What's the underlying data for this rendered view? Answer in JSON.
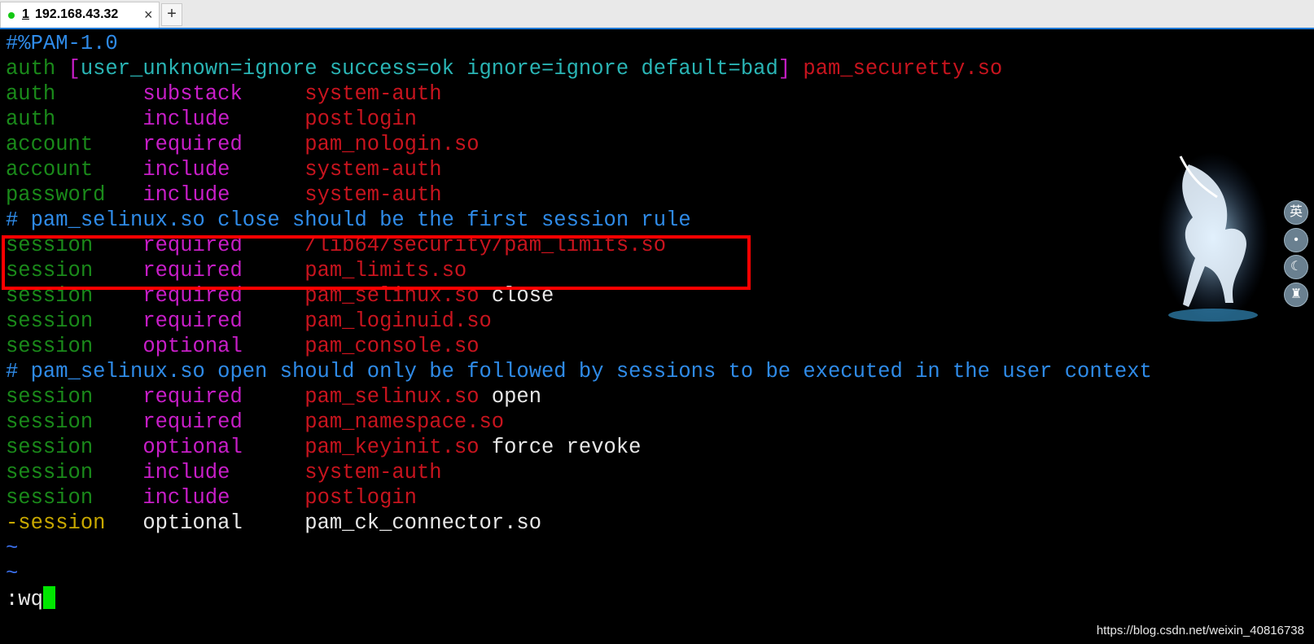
{
  "tab": {
    "number": "1",
    "title": "192.168.43.32",
    "close": "×",
    "new_tab": "+"
  },
  "lines": [
    [
      {
        "t": "#%PAM-1.0",
        "c": "c-blue"
      }
    ],
    [
      {
        "t": "auth ",
        "c": "c-green"
      },
      {
        "t": "[",
        "c": "c-magenta"
      },
      {
        "t": "user_unknown=ignore success=ok ignore=ignore default=bad",
        "c": "c-teal"
      },
      {
        "t": "] ",
        "c": "c-magenta"
      },
      {
        "t": "pam_securetty.so",
        "c": "c-red"
      }
    ],
    [
      {
        "t": "auth       ",
        "c": "c-green"
      },
      {
        "t": "substack     ",
        "c": "c-magenta"
      },
      {
        "t": "system-auth",
        "c": "c-red"
      }
    ],
    [
      {
        "t": "auth       ",
        "c": "c-green"
      },
      {
        "t": "include      ",
        "c": "c-magenta"
      },
      {
        "t": "postlogin",
        "c": "c-red"
      }
    ],
    [
      {
        "t": "account    ",
        "c": "c-green"
      },
      {
        "t": "required     ",
        "c": "c-magenta"
      },
      {
        "t": "pam_nologin.so",
        "c": "c-red"
      }
    ],
    [
      {
        "t": "account    ",
        "c": "c-green"
      },
      {
        "t": "include      ",
        "c": "c-magenta"
      },
      {
        "t": "system-auth",
        "c": "c-red"
      }
    ],
    [
      {
        "t": "password   ",
        "c": "c-green"
      },
      {
        "t": "include      ",
        "c": "c-magenta"
      },
      {
        "t": "system-auth",
        "c": "c-red"
      }
    ],
    [
      {
        "t": "# pam_selinux.so close should be the first session rule",
        "c": "c-blue"
      }
    ],
    [
      {
        "t": "session    ",
        "c": "c-green"
      },
      {
        "t": "required     ",
        "c": "c-magenta"
      },
      {
        "t": "/lib64/security/pam_limits.so",
        "c": "c-red"
      }
    ],
    [
      {
        "t": "session    ",
        "c": "c-green"
      },
      {
        "t": "required     ",
        "c": "c-magenta"
      },
      {
        "t": "pam_limits.so",
        "c": "c-red"
      }
    ],
    [
      {
        "t": "session    ",
        "c": "c-green"
      },
      {
        "t": "required     ",
        "c": "c-magenta"
      },
      {
        "t": "pam_selinux.so ",
        "c": "c-red"
      },
      {
        "t": "close",
        "c": "c-white"
      }
    ],
    [
      {
        "t": "session    ",
        "c": "c-green"
      },
      {
        "t": "required     ",
        "c": "c-magenta"
      },
      {
        "t": "pam_loginuid.so",
        "c": "c-red"
      }
    ],
    [
      {
        "t": "session    ",
        "c": "c-green"
      },
      {
        "t": "optional     ",
        "c": "c-magenta"
      },
      {
        "t": "pam_console.so",
        "c": "c-red"
      }
    ],
    [
      {
        "t": "# pam_selinux.so open should only be followed by sessions to be executed in the user context",
        "c": "c-blue"
      }
    ],
    [
      {
        "t": "session    ",
        "c": "c-green"
      },
      {
        "t": "required     ",
        "c": "c-magenta"
      },
      {
        "t": "pam_selinux.so ",
        "c": "c-red"
      },
      {
        "t": "open",
        "c": "c-white"
      }
    ],
    [
      {
        "t": "session    ",
        "c": "c-green"
      },
      {
        "t": "required     ",
        "c": "c-magenta"
      },
      {
        "t": "pam_namespace.so",
        "c": "c-red"
      }
    ],
    [
      {
        "t": "session    ",
        "c": "c-green"
      },
      {
        "t": "optional     ",
        "c": "c-magenta"
      },
      {
        "t": "pam_keyinit.so ",
        "c": "c-red"
      },
      {
        "t": "force revoke",
        "c": "c-white"
      }
    ],
    [
      {
        "t": "session    ",
        "c": "c-green"
      },
      {
        "t": "include      ",
        "c": "c-magenta"
      },
      {
        "t": "system-auth",
        "c": "c-red"
      }
    ],
    [
      {
        "t": "session    ",
        "c": "c-green"
      },
      {
        "t": "include      ",
        "c": "c-magenta"
      },
      {
        "t": "postlogin",
        "c": "c-red"
      }
    ],
    [
      {
        "t": "-session   ",
        "c": "c-yellow"
      },
      {
        "t": "optional     ",
        "c": "c-white"
      },
      {
        "t": "pam_ck_connector.so",
        "c": "c-white"
      }
    ],
    [
      {
        "t": "~",
        "c": "c-brtblue"
      }
    ],
    [
      {
        "t": "~",
        "c": "c-brtblue"
      }
    ]
  ],
  "command": ":wq",
  "side_buttons": [
    "英",
    "•",
    "☾",
    "♜"
  ],
  "watermark": "https://blog.csdn.net/weixin_40816738",
  "colors": {
    "tab_accent": "#1e78d6",
    "highlight_box": "#ff0000",
    "cursor": "#00e600"
  }
}
